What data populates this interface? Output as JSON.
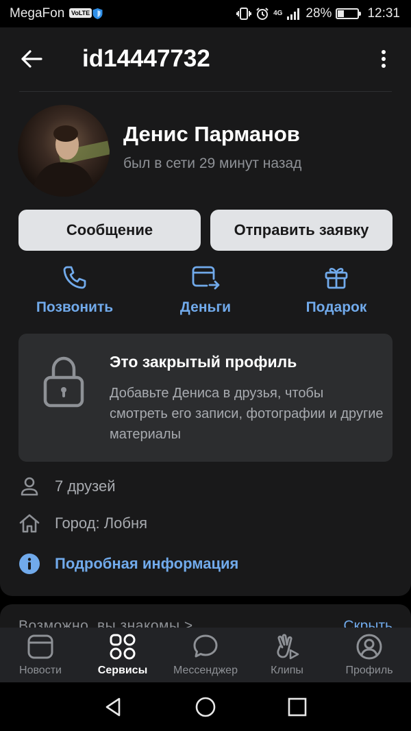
{
  "status_bar": {
    "carrier": "MegaFon",
    "volte": "VoLTE",
    "network": "4G",
    "battery_percent": "28%",
    "battery_level": 0.28,
    "time": "12:31"
  },
  "header": {
    "title": "id14447732",
    "back_icon": "arrow-left-icon",
    "menu_icon": "more-vertical-icon"
  },
  "profile": {
    "name": "Денис Парманов",
    "last_seen": "был в сети 29 минут назад"
  },
  "buttons": {
    "message": "Сообщение",
    "friend_request": "Отправить заявку"
  },
  "actions": [
    {
      "label": "Позвонить",
      "icon": "phone-icon"
    },
    {
      "label": "Деньги",
      "icon": "money-transfer-icon"
    },
    {
      "label": "Подарок",
      "icon": "gift-icon"
    }
  ],
  "closed_profile": {
    "title": "Это закрытый профиль",
    "text": "Добавьте Дениса в друзья, чтобы смотреть его записи, фотографии и другие материалы"
  },
  "info": {
    "friends": "7 друзей",
    "city": "Город: Лобня",
    "details": "Подробная информация"
  },
  "suggestions": {
    "title": "Возможно, вы знакомы >",
    "hide": "Скрыть"
  },
  "tabs": [
    {
      "label": "Новости",
      "icon": "news-icon",
      "active": false
    },
    {
      "label": "Сервисы",
      "icon": "services-icon",
      "active": true
    },
    {
      "label": "Мессенджер",
      "icon": "messenger-icon",
      "active": false
    },
    {
      "label": "Клипы",
      "icon": "clips-icon",
      "active": false
    },
    {
      "label": "Профиль",
      "icon": "profile-icon",
      "active": false
    }
  ],
  "colors": {
    "background": "#19191a",
    "accent": "#71aaeb",
    "button_bg": "#e1e3e6",
    "tabbar_bg": "#222326"
  }
}
